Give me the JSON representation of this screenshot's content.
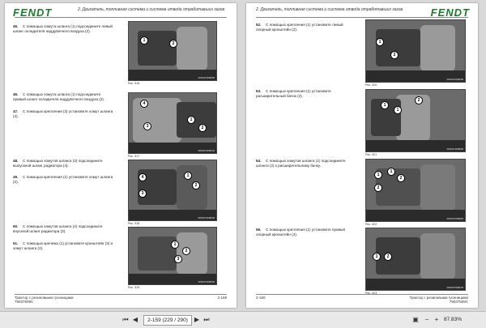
{
  "left_page": {
    "brand": "FENDT",
    "header": "2. Двигатель, топливная система и система отвода отработавших газов",
    "steps": [
      {
        "num": "46.",
        "text": "С помощью хомута шланга (1) подсоедините левый шланг охладителя наддувочного воздуха (2)."
      },
      {
        "num": "46.",
        "text": "С помощью хомута шланга (1) подсоедините правый шланг охладителя наддувочного воздуха (2)."
      },
      {
        "num": "47.",
        "text": "С помощью крепления (3) установите хомут шланга (4)."
      },
      {
        "num": "48.",
        "text": "С помощью хомутов шланга (3) подсоедините выпускной шланг радиатора (4)."
      },
      {
        "num": "49.",
        "text": "С помощью крепления (1) установите хомут шланга (2)."
      },
      {
        "num": "50.",
        "text": "С помощью хомутов шланга (4) подсоедините впускной шланг радиатора (3)."
      },
      {
        "num": "51.",
        "text": "С помощью крепежа (1) установите кронштейн (3) и хомут шланга (2)."
      }
    ],
    "figures": [
      {
        "cap": "Рис. 516",
        "code": "FMU0716660R"
      },
      {
        "cap": "Рис. 517",
        "code": "FMU0716661R"
      },
      {
        "cap": "Рис. 518",
        "code": "FMU0716662R"
      },
      {
        "cap": "Рис. 519",
        "code": "FMU0716663R"
      }
    ],
    "footer_line1": "Трактор с резиновыми гусеницами",
    "footer_line2": "79037509C",
    "page_no": "2-159"
  },
  "right_page": {
    "brand": "FENDT",
    "header": "2. Двигатель, топливная система и система отвода отработавших газов",
    "steps": [
      {
        "num": "52.",
        "text": "С помощью крепления (1) установите левый опорный кронштейн (2)."
      },
      {
        "num": "53.",
        "text": "С помощью крепления (1) установите расширительный бачок (2)."
      },
      {
        "num": "54.",
        "text": "С помощью хомутов шланга (1) подсоедините шланги (2) к расширительному бачку."
      },
      {
        "num": "55.",
        "text": "С помощью крепления (1) установите правый опорный кронштейн (2)."
      }
    ],
    "figures": [
      {
        "cap": "Рис. 520",
        "code": "FMU0716664R"
      },
      {
        "cap": "Рис. 521",
        "code": "FMU0716665R"
      },
      {
        "cap": "Рис. 522",
        "code": "FMU0716666R"
      },
      {
        "cap": "Рис. 523",
        "code": "FMU0716667R"
      }
    ],
    "footer_line1": "Трактор с резиновыми гусеницами",
    "footer_line2": "79037509C",
    "page_no": "2-160"
  },
  "toolbar": {
    "page_indicator": "2-159 (229 / 290)",
    "zoom": "87.83%",
    "first_icon": "first-page-icon",
    "prev_icon": "prev-page-icon",
    "next_icon": "next-page-icon",
    "last_icon": "last-page-icon"
  }
}
